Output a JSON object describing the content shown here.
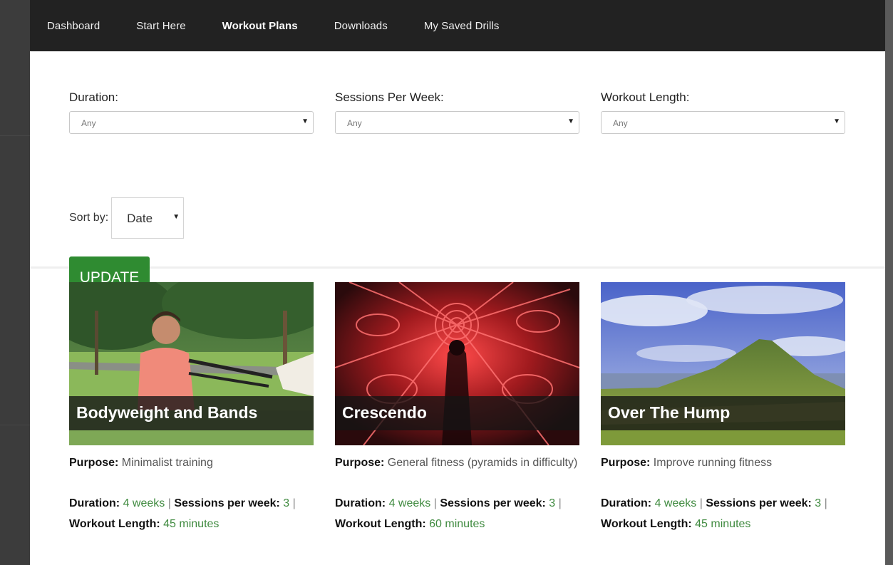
{
  "nav": {
    "items": [
      {
        "label": "Dashboard",
        "active": false
      },
      {
        "label": "Start Here",
        "active": false
      },
      {
        "label": "Workout Plans",
        "active": true
      },
      {
        "label": "Downloads",
        "active": false
      },
      {
        "label": "My Saved Drills",
        "active": false
      }
    ]
  },
  "filters": {
    "duration": {
      "label": "Duration:",
      "value": "Any"
    },
    "sessions": {
      "label": "Sessions Per Week:",
      "value": "Any"
    },
    "length": {
      "label": "Workout Length:",
      "value": "Any"
    },
    "sort": {
      "label": "Sort by:",
      "value": "Date"
    },
    "update_label": "UPDATE"
  },
  "labels": {
    "purpose": "Purpose:",
    "duration": "Duration:",
    "sessions": "Sessions per week:",
    "length": "Workout Length:",
    "sep": "|"
  },
  "cards": [
    {
      "title": "Bodyweight and Bands",
      "purpose": "Minimalist training",
      "duration": "4 weeks",
      "sessions": "3",
      "length": "45 minutes"
    },
    {
      "title": "Crescendo",
      "purpose": "General fitness (pyramids in difficulty)",
      "duration": "4 weeks",
      "sessions": "3",
      "length": "60 minutes"
    },
    {
      "title": "Over The Hump",
      "purpose": "Improve running fitness",
      "duration": "4 weeks",
      "sessions": "3",
      "length": "45 minutes"
    }
  ],
  "colors": {
    "nav_bg": "#222222",
    "accent_green": "#2f8b31",
    "value_green": "#3f8a3f"
  }
}
